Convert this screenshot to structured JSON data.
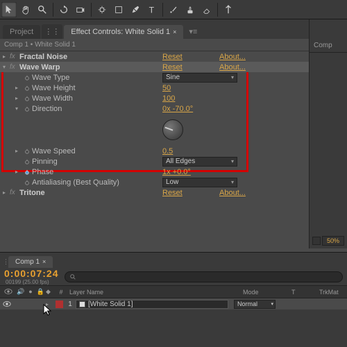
{
  "tabs": {
    "project": "Project",
    "ec": "Effect Controls: White Solid 1",
    "right": "Comp"
  },
  "ec_header": "Comp 1 • White Solid 1",
  "effects": {
    "fractal": {
      "name": "Fractal Noise",
      "reset": "Reset",
      "about": "About..."
    },
    "wave": {
      "name": "Wave Warp",
      "reset": "Reset",
      "about": "About...",
      "props": {
        "type": {
          "label": "Wave Type",
          "value": "Sine"
        },
        "height": {
          "label": "Wave Height",
          "value": "50"
        },
        "width": {
          "label": "Wave Width",
          "value": "100"
        },
        "direction": {
          "label": "Direction",
          "value": "0x -70.0°"
        },
        "speed": {
          "label": "Wave Speed",
          "value": "0.5"
        },
        "pinning": {
          "label": "Pinning",
          "value": "All Edges"
        },
        "phase": {
          "label": "Phase",
          "value": "1x +0.0°"
        },
        "aa": {
          "label": "Antialiasing (Best Quality)",
          "value": "Low"
        }
      }
    },
    "tritone": {
      "name": "Tritone",
      "reset": "Reset",
      "about": "About..."
    }
  },
  "zoom": "50%",
  "timeline": {
    "tab": "Comp 1",
    "timecode": "0:00:07:24",
    "sub": "00199 (25.00 fps)",
    "cols": {
      "num": "#",
      "layername": "Layer Name",
      "mode": "Mode",
      "t": "T",
      "trkmat": "TrkMat"
    },
    "layer": {
      "num": "1",
      "name": "[White Solid 1]",
      "mode": "Normal"
    }
  }
}
